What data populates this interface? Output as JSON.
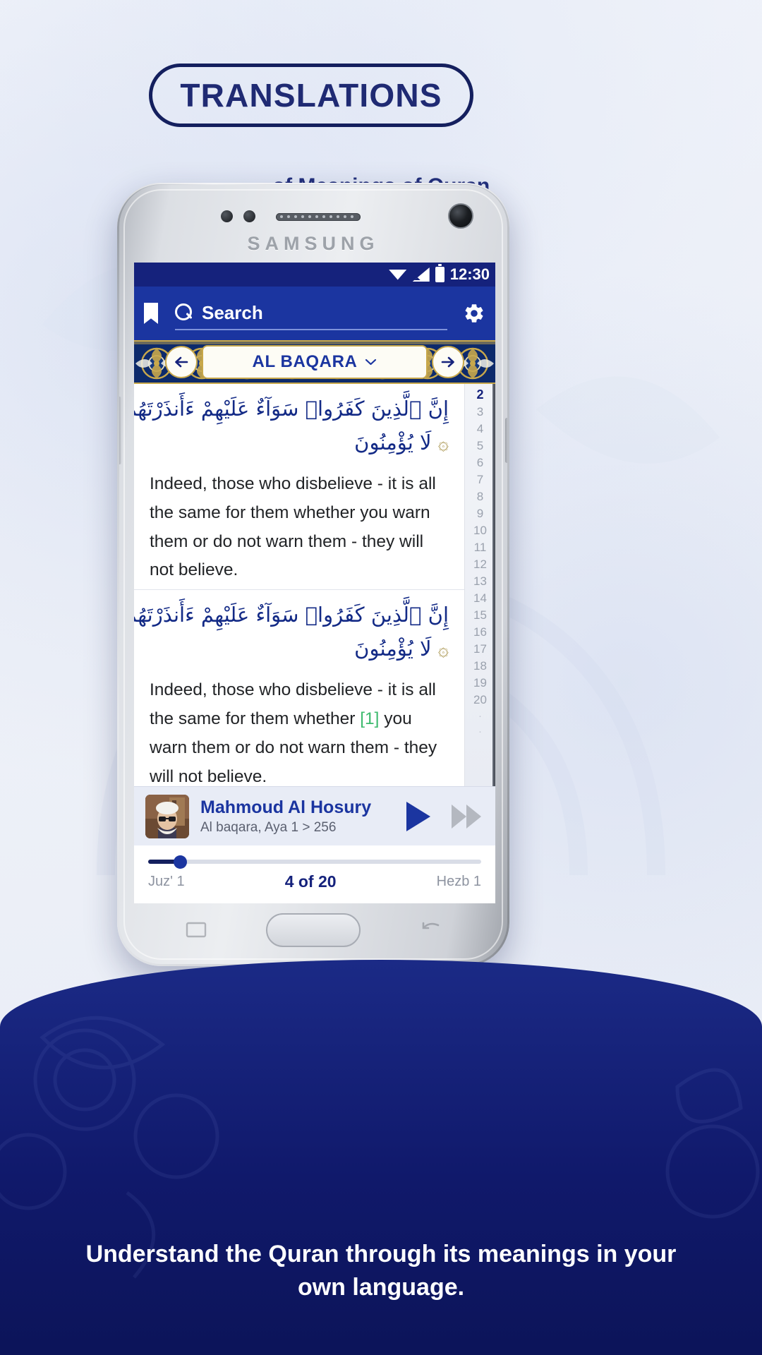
{
  "poster": {
    "headline": "TRANSLATIONS",
    "subhead": "of Meanings of Quran",
    "caption": "Understand the Quran through its meanings in your own language.",
    "accent_navy": "#141f5e",
    "accent_blue": "#1b35a0",
    "bottom_band": "#10196b"
  },
  "phone": {
    "brand": "SAMSUNG"
  },
  "status_bar": {
    "time": "12:30",
    "icons": [
      "wifi-icon",
      "signal-icon",
      "battery-icon"
    ]
  },
  "app_bar": {
    "bookmark_icon": "bookmark-icon",
    "search_icon": "search-icon",
    "search_value": "",
    "search_placeholder": "Search",
    "settings_icon": "gear-icon"
  },
  "surah_nav": {
    "prev_icon": "arrow-left-icon",
    "next_icon": "arrow-right-icon",
    "surah_name": "AL BAQARA",
    "dropdown_icon": "chevron-down-icon"
  },
  "verses": [
    {
      "arabic_line_1": "إِنَّ ٱلَّذِينَ كَفَرُوا۟ سَوَآءٌ عَلَيْهِمْ ءَأَنذَرْتَهُمْ أَمْ لَمْ تُنذِرْهُمْ",
      "arabic_line_2": "لَا يُؤْمِنُونَ",
      "ayah_mark": "۞",
      "translation": "Indeed, those who disbelieve - it is all the same for them whether you warn them or do not warn them - they will not believe.",
      "footnote_marker": ""
    },
    {
      "arabic_line_1": "إِنَّ ٱلَّذِينَ كَفَرُوا۟ سَوَآءٌ عَلَيْهِمْ ءَأَنذَرْتَهُمْ أَمْ لَمْ تُنذِرْهُمْ",
      "arabic_line_2": "لَا يُؤْمِنُونَ",
      "ayah_mark": "۞",
      "translation_before": "Indeed, those who disbelieve - it is all the same for them whether ",
      "footnote_marker": "[1]",
      "translation_after": " you warn them or do not warn them - they will not believe."
    }
  ],
  "verse_rail": {
    "active": "2",
    "numbers": [
      "2",
      "3",
      "4",
      "5",
      "6",
      "7",
      "8",
      "9",
      "10",
      "11",
      "12",
      "13",
      "14",
      "15",
      "16",
      "17",
      "18",
      "19",
      "20"
    ],
    "overflow": [
      "·",
      "·"
    ]
  },
  "player": {
    "avatar": "reciter-photo",
    "reciter": "Mahmoud Al Hosury",
    "subtitle": "Al baqara, Aya 1 > 256",
    "play_icon": "play-icon",
    "next_icon": "fast-forward-icon"
  },
  "bottom_bar": {
    "juz_label": "Juz' 1",
    "page_label": "4 of 20",
    "hezb_label": "Hezb 1",
    "slider_percent": 8
  }
}
